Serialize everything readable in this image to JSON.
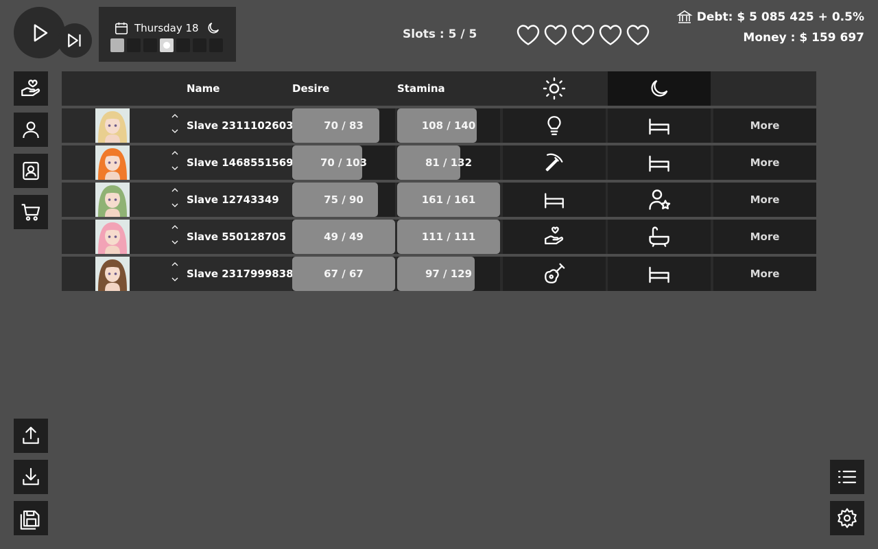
{
  "header": {
    "day_label": "Thursday 18",
    "days": [
      {
        "state": "past"
      },
      {
        "state": "empty"
      },
      {
        "state": "empty"
      },
      {
        "state": "current"
      },
      {
        "state": "empty"
      },
      {
        "state": "empty"
      },
      {
        "state": "empty"
      }
    ],
    "slots_label": "Slots : 5 / 5",
    "hearts": 5,
    "debt_label": "Debt: $ 5 085 425 + 0.5%",
    "money_label": "Money : $ 159 697"
  },
  "sidebar": {
    "buttons": [
      "hand-heart-icon",
      "user-icon",
      "portrait-icon",
      "cart-icon"
    ],
    "bottom_buttons": [
      "upload-icon",
      "download-icon",
      "save-icon"
    ]
  },
  "table": {
    "headers": {
      "name": "Name",
      "desire": "Desire",
      "stamina": "Stamina",
      "day_icon": "sun-icon",
      "night_icon": "moon-icon"
    },
    "more_label": "More",
    "rows": [
      {
        "name": "Slave 2311102603",
        "desire": {
          "value": 70,
          "max": 83,
          "label": "70 / 83"
        },
        "stamina": {
          "value": 108,
          "max": 140,
          "label": "108 / 140"
        },
        "day_action": "lightbulb-icon",
        "night_action": "bed-icon",
        "hair": "#e9cf8f"
      },
      {
        "name": "Slave 1468551569",
        "desire": {
          "value": 70,
          "max": 103,
          "label": "70 / 103"
        },
        "stamina": {
          "value": 81,
          "max": 132,
          "label": "81 / 132"
        },
        "day_action": "pickaxe-icon",
        "night_action": "bed-icon",
        "hair": "#f07a2a"
      },
      {
        "name": "Slave 12743349",
        "desire": {
          "value": 75,
          "max": 90,
          "label": "75 / 90"
        },
        "stamina": {
          "value": 161,
          "max": 161,
          "label": "161 / 161"
        },
        "day_action": "bed-icon",
        "night_action": "user-star-icon",
        "hair": "#8fb274"
      },
      {
        "name": "Slave 550128705",
        "desire": {
          "value": 49,
          "max": 49,
          "label": "49 / 49"
        },
        "stamina": {
          "value": 111,
          "max": 111,
          "label": "111 / 111"
        },
        "day_action": "hand-heart-icon",
        "night_action": "bath-icon",
        "hair": "#f2a3b6"
      },
      {
        "name": "Slave 2317999838",
        "desire": {
          "value": 67,
          "max": 67,
          "label": "67 / 67"
        },
        "stamina": {
          "value": 97,
          "max": 129,
          "label": "97 / 129"
        },
        "day_action": "guitar-icon",
        "night_action": "bed-icon",
        "hair": "#7a5234"
      }
    ]
  },
  "corner": {
    "buttons": [
      "list-icon",
      "gear-icon"
    ]
  }
}
